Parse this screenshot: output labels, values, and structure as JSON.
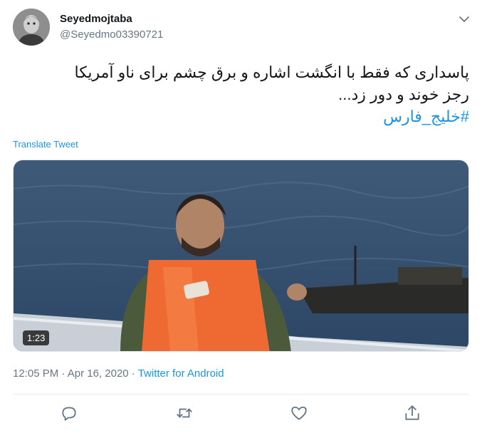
{
  "author": {
    "display_name": "Seyedmojtaba",
    "handle": "@Seyedmo03390721"
  },
  "tweet": {
    "text_line1": "پاسداری که فقط با انگشت اشاره و برق چشم برای ناو آمریکا",
    "text_line2": "رجز خوند و دور زد...",
    "hashtag": "#خلیج_فارس"
  },
  "translate_label": "Translate Tweet",
  "media": {
    "duration": "1:23"
  },
  "meta": {
    "time": "12:05 PM",
    "separator1": " · ",
    "date": "Apr 16, 2020",
    "separator2": " · ",
    "source": "Twitter for Android"
  },
  "icons": {
    "more": "chevron-down-icon",
    "reply": "reply-icon",
    "retweet": "retweet-icon",
    "like": "heart-icon",
    "share": "share-icon"
  },
  "colors": {
    "link": "#1b95e0",
    "secondary_text": "#657786",
    "icon": "#657786"
  }
}
